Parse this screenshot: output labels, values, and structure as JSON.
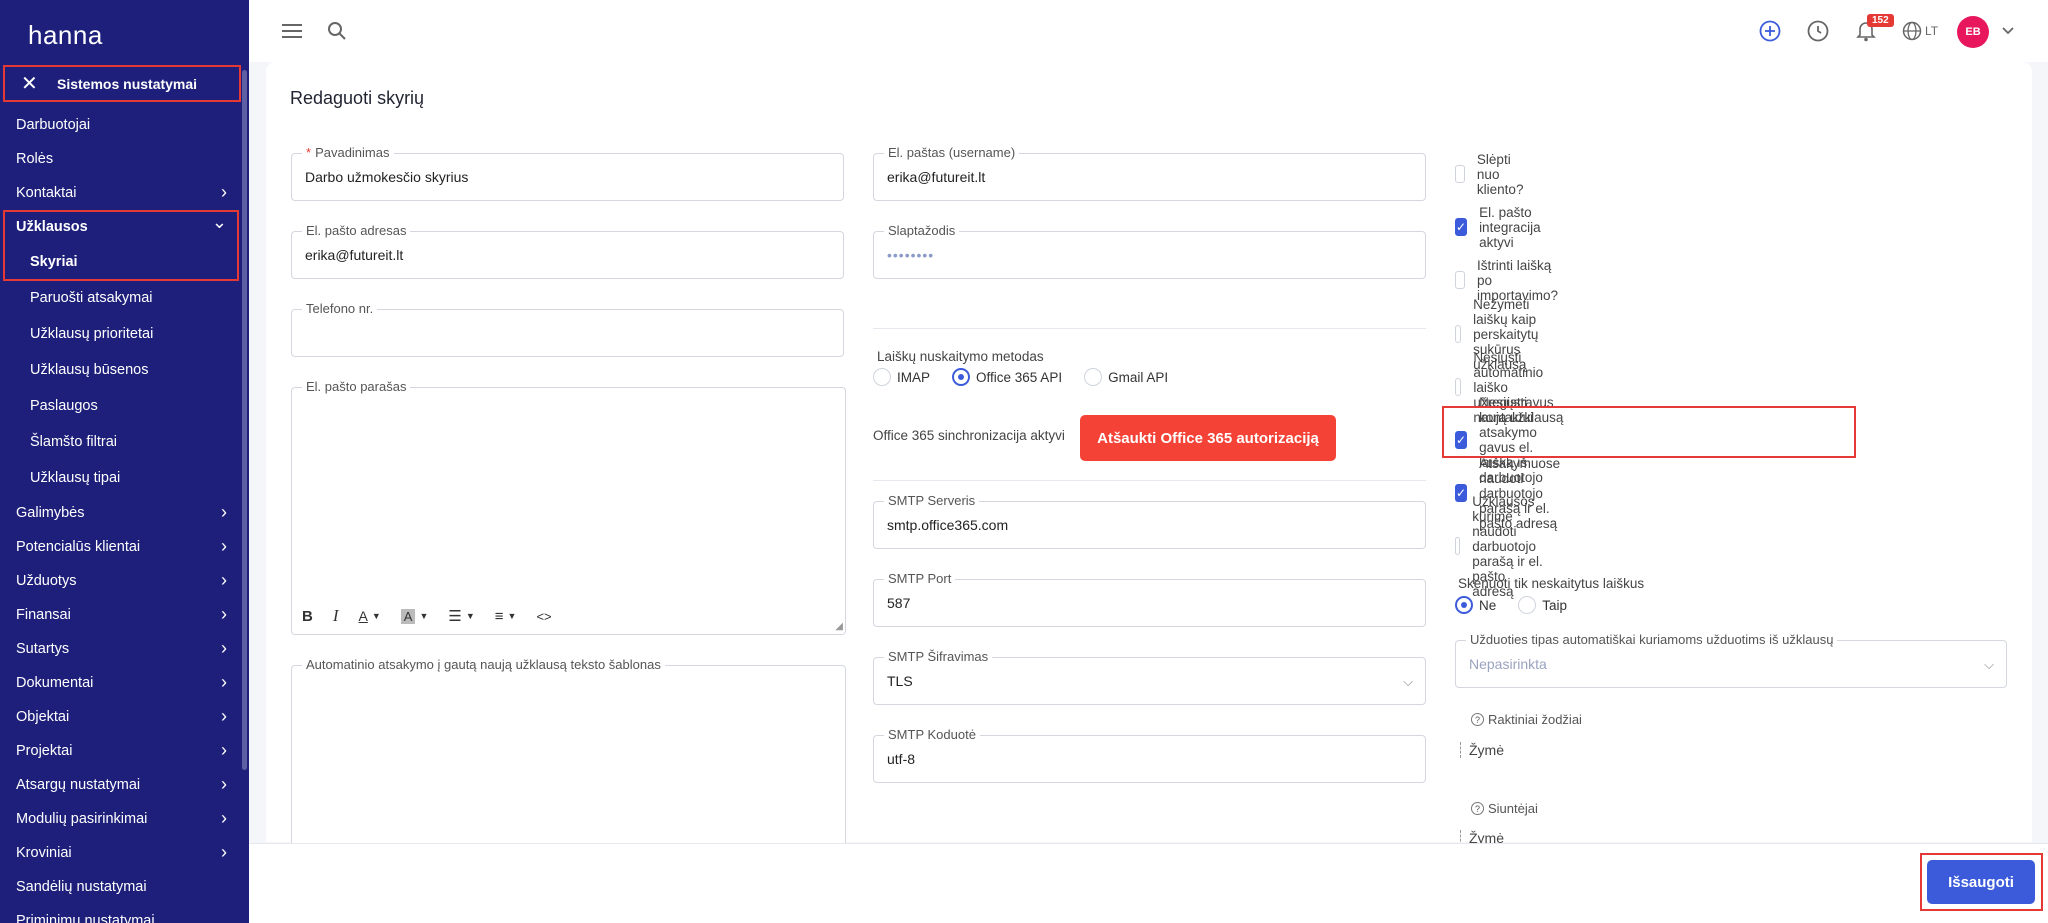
{
  "app": {
    "logo": "hanna"
  },
  "sidebar": {
    "section_title": "Sistemos nustatymai",
    "items": [
      {
        "label": "Darbuotojai",
        "chev": false,
        "sub": false
      },
      {
        "label": "Rolės",
        "chev": false,
        "sub": false
      },
      {
        "label": "Kontaktai",
        "chev": true,
        "sub": false
      },
      {
        "label": "Užklausos",
        "chev": true,
        "sub": false,
        "bold": true,
        "expanded": true
      },
      {
        "label": "Skyriai",
        "chev": false,
        "sub": true,
        "bold": true
      },
      {
        "label": "Paruošti atsakymai",
        "chev": false,
        "sub": true
      },
      {
        "label": "Užklausų prioritetai",
        "chev": false,
        "sub": true
      },
      {
        "label": "Užklausų būsenos",
        "chev": false,
        "sub": true
      },
      {
        "label": "Paslaugos",
        "chev": false,
        "sub": true
      },
      {
        "label": "Šlamšto filtrai",
        "chev": false,
        "sub": true
      },
      {
        "label": "Užklausų tipai",
        "chev": false,
        "sub": true
      },
      {
        "label": "Galimybės",
        "chev": true,
        "sub": false
      },
      {
        "label": "Potencialūs klientai",
        "chev": true,
        "sub": false
      },
      {
        "label": "Užduotys",
        "chev": true,
        "sub": false
      },
      {
        "label": "Finansai",
        "chev": true,
        "sub": false
      },
      {
        "label": "Sutartys",
        "chev": true,
        "sub": false
      },
      {
        "label": "Dokumentai",
        "chev": true,
        "sub": false
      },
      {
        "label": "Objektai",
        "chev": true,
        "sub": false
      },
      {
        "label": "Projektai",
        "chev": true,
        "sub": false
      },
      {
        "label": "Atsargų nustatymai",
        "chev": true,
        "sub": false
      },
      {
        "label": "Modulių pasirinkimai",
        "chev": true,
        "sub": false
      },
      {
        "label": "Kroviniai",
        "chev": true,
        "sub": false
      },
      {
        "label": "Sandėlių nustatymai",
        "chev": false,
        "sub": false
      },
      {
        "label": "Priminimų nustatymai",
        "chev": false,
        "sub": false
      }
    ]
  },
  "topbar": {
    "notifications_count": "152",
    "language": "LT",
    "avatar_initials": "EB"
  },
  "page": {
    "title": "Redaguoti skyrių"
  },
  "form": {
    "name_label": "Pavadinimas",
    "name_value": "Darbo užmokesčio skyrius",
    "email_label": "El. pašto adresas",
    "email_value": "erika@futureit.lt",
    "phone_label": "Telefono nr.",
    "phone_value": "",
    "signature_label": "El. pašto parašas",
    "autoreply_label": "Automatinio atsakymo į gautą naują užklausą teksto šablonas",
    "username_label": "El. paštas (username)",
    "username_value": "erika@futureit.lt",
    "password_label": "Slaptažodis",
    "password_value": "••••••••",
    "read_method_label": "Laiškų nuskaitymo metodas",
    "read_methods": [
      "IMAP",
      "Office 365 API",
      "Gmail API"
    ],
    "sync_status": "Office 365 sinchronizacija aktyvi",
    "revoke_button": "Atšaukti Office 365 autorizaciją",
    "smtp_server_label": "SMTP Serveris",
    "smtp_server_value": "smtp.office365.com",
    "smtp_port_label": "SMTP Port",
    "smtp_port_value": "587",
    "smtp_enc_label": "SMTP Šifravimas",
    "smtp_enc_value": "TLS",
    "smtp_encoding_label": "SMTP Koduotė",
    "smtp_encoding_value": "utf-8",
    "checkboxes": [
      {
        "label": "Slėpti nuo kliento?",
        "checked": false
      },
      {
        "label": "El. pašto integracija aktyvi",
        "checked": true
      },
      {
        "label": "Ištrinti laišką po importavimo?",
        "checked": false
      },
      {
        "label": "Nežymėti laiškų kaip perskaitytų sukūrus užklausą",
        "checked": false
      },
      {
        "label": "Nesiųsti automatinio laiško užregistravus naują užklausą",
        "checked": false
      },
      {
        "label": "Nesiųsti kontaktui atsakymo gavus el. laišką iš darbuotojo",
        "checked": true
      },
      {
        "label": "Atsakymuose naudoti darbuotojo parašą ir el. pašto adresą",
        "checked": true
      },
      {
        "label": "Užklausos kūrime naudoti darbuotojo parašą ir el. pašto adresą",
        "checked": false
      }
    ],
    "scan_label": "Skenuoti tik neskaitytus laiškus",
    "scan_options": [
      "Ne",
      "Taip"
    ],
    "task_type_label": "Užduoties tipas automatiškai kuriamoms užduotims iš užklausų",
    "task_type_placeholder": "Nepasirinkta",
    "keywords_label": "Raktiniai žodžiai",
    "keywords_placeholder": "Žymė",
    "senders_label": "Siuntėjai",
    "senders_placeholder": "Žymė"
  },
  "footer": {
    "save_label": "Išsaugoti"
  },
  "colors": {
    "sidebar_bg": "#1d1f7a",
    "primary": "#3b5bdb",
    "danger": "#f44336",
    "highlight": "#e53935",
    "avatar": "#e8175d"
  }
}
